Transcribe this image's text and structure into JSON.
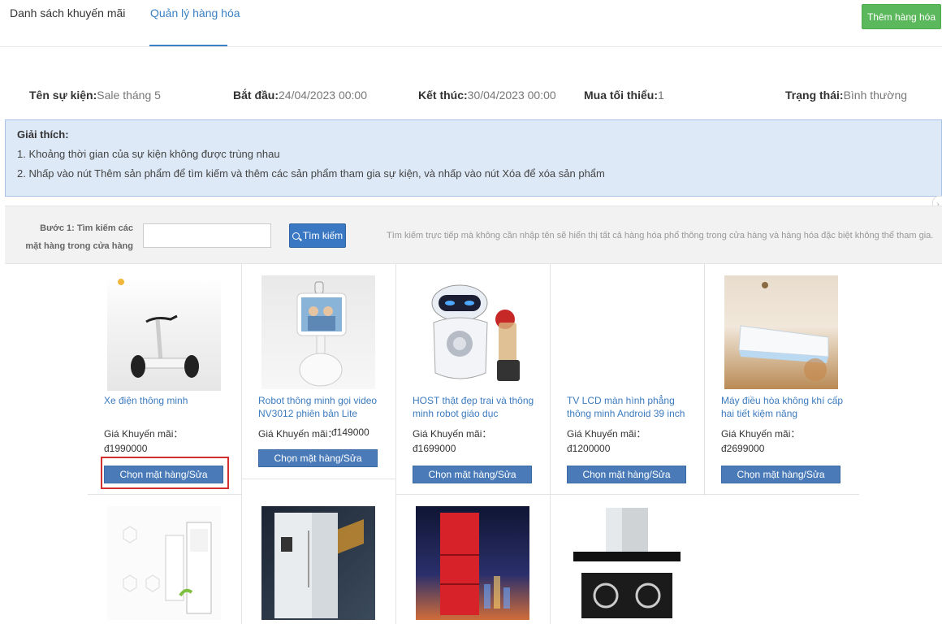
{
  "tabs": [
    {
      "label": "Danh sách khuyến mãi"
    },
    {
      "label": "Quản lý hàng hóa"
    }
  ],
  "add_button": "Thêm hàng hóa",
  "event": {
    "name_label": "Tên sự kiện:",
    "name_value": "Sale tháng 5",
    "start_label": "Bắt đầu:",
    "start_value": "24/04/2023 00:00",
    "end_label": "Kết thúc:",
    "end_value": "30/04/2023 00:00",
    "min_label": "Mua tối thiểu:",
    "min_value": "1",
    "status_label": "Trạng thái:",
    "status_value": "Bình thường"
  },
  "explanation": {
    "title": "Giải thích:",
    "line1": "1. Khoảng thời gian của sự kiện không được trùng nhau",
    "line2": "2. Nhấp vào nút Thêm sản phẩm để tìm kiếm và thêm các sản phẩm tham gia sự kiện, và nhấp vào nút Xóa để xóa sản phẩm"
  },
  "search": {
    "step_label": "Bước 1: Tìm kiếm các mặt hàng trong cửa hàng",
    "input_value": "",
    "button": "Tìm kiếm",
    "hint": "Tìm kiếm trực tiếp mà không cần nhập tên sẽ hiển thị tất cả hàng hóa phổ thông trong cửa hàng và hàng hóa đặc biệt không thể tham gia."
  },
  "price_label": "Giá Khuyến mãi：",
  "choose_label": "Chọn mặt hàng/Sửa",
  "products": [
    {
      "name": "Xe điện thông minh",
      "price": "đ1990000",
      "image": "segway-image"
    },
    {
      "name": "Robot thông minh gọi video NV3012 phiên bản Lite",
      "price": "đ149000",
      "image": "video-robot-image"
    },
    {
      "name": "HOST thật đẹp trai và thông minh robot giáo dục",
      "price": "đ1699000",
      "image": "edu-robot-image"
    },
    {
      "name": "TV LCD màn hình phẳng thông minh Android 39 inch",
      "price": "đ1200000",
      "image": "tv-image"
    },
    {
      "name": "Máy điều hòa không khí cấp hai tiết kiệm năng",
      "price": "đ2699000",
      "image": "aircon-image"
    },
    {
      "name": "",
      "price": "",
      "image": "standing-aircon-image"
    },
    {
      "name": "",
      "price": "",
      "image": "fridge-white-image"
    },
    {
      "name": "",
      "price": "",
      "image": "fridge-red-image"
    },
    {
      "name": "",
      "price": "",
      "image": "range-hood-image"
    }
  ]
}
